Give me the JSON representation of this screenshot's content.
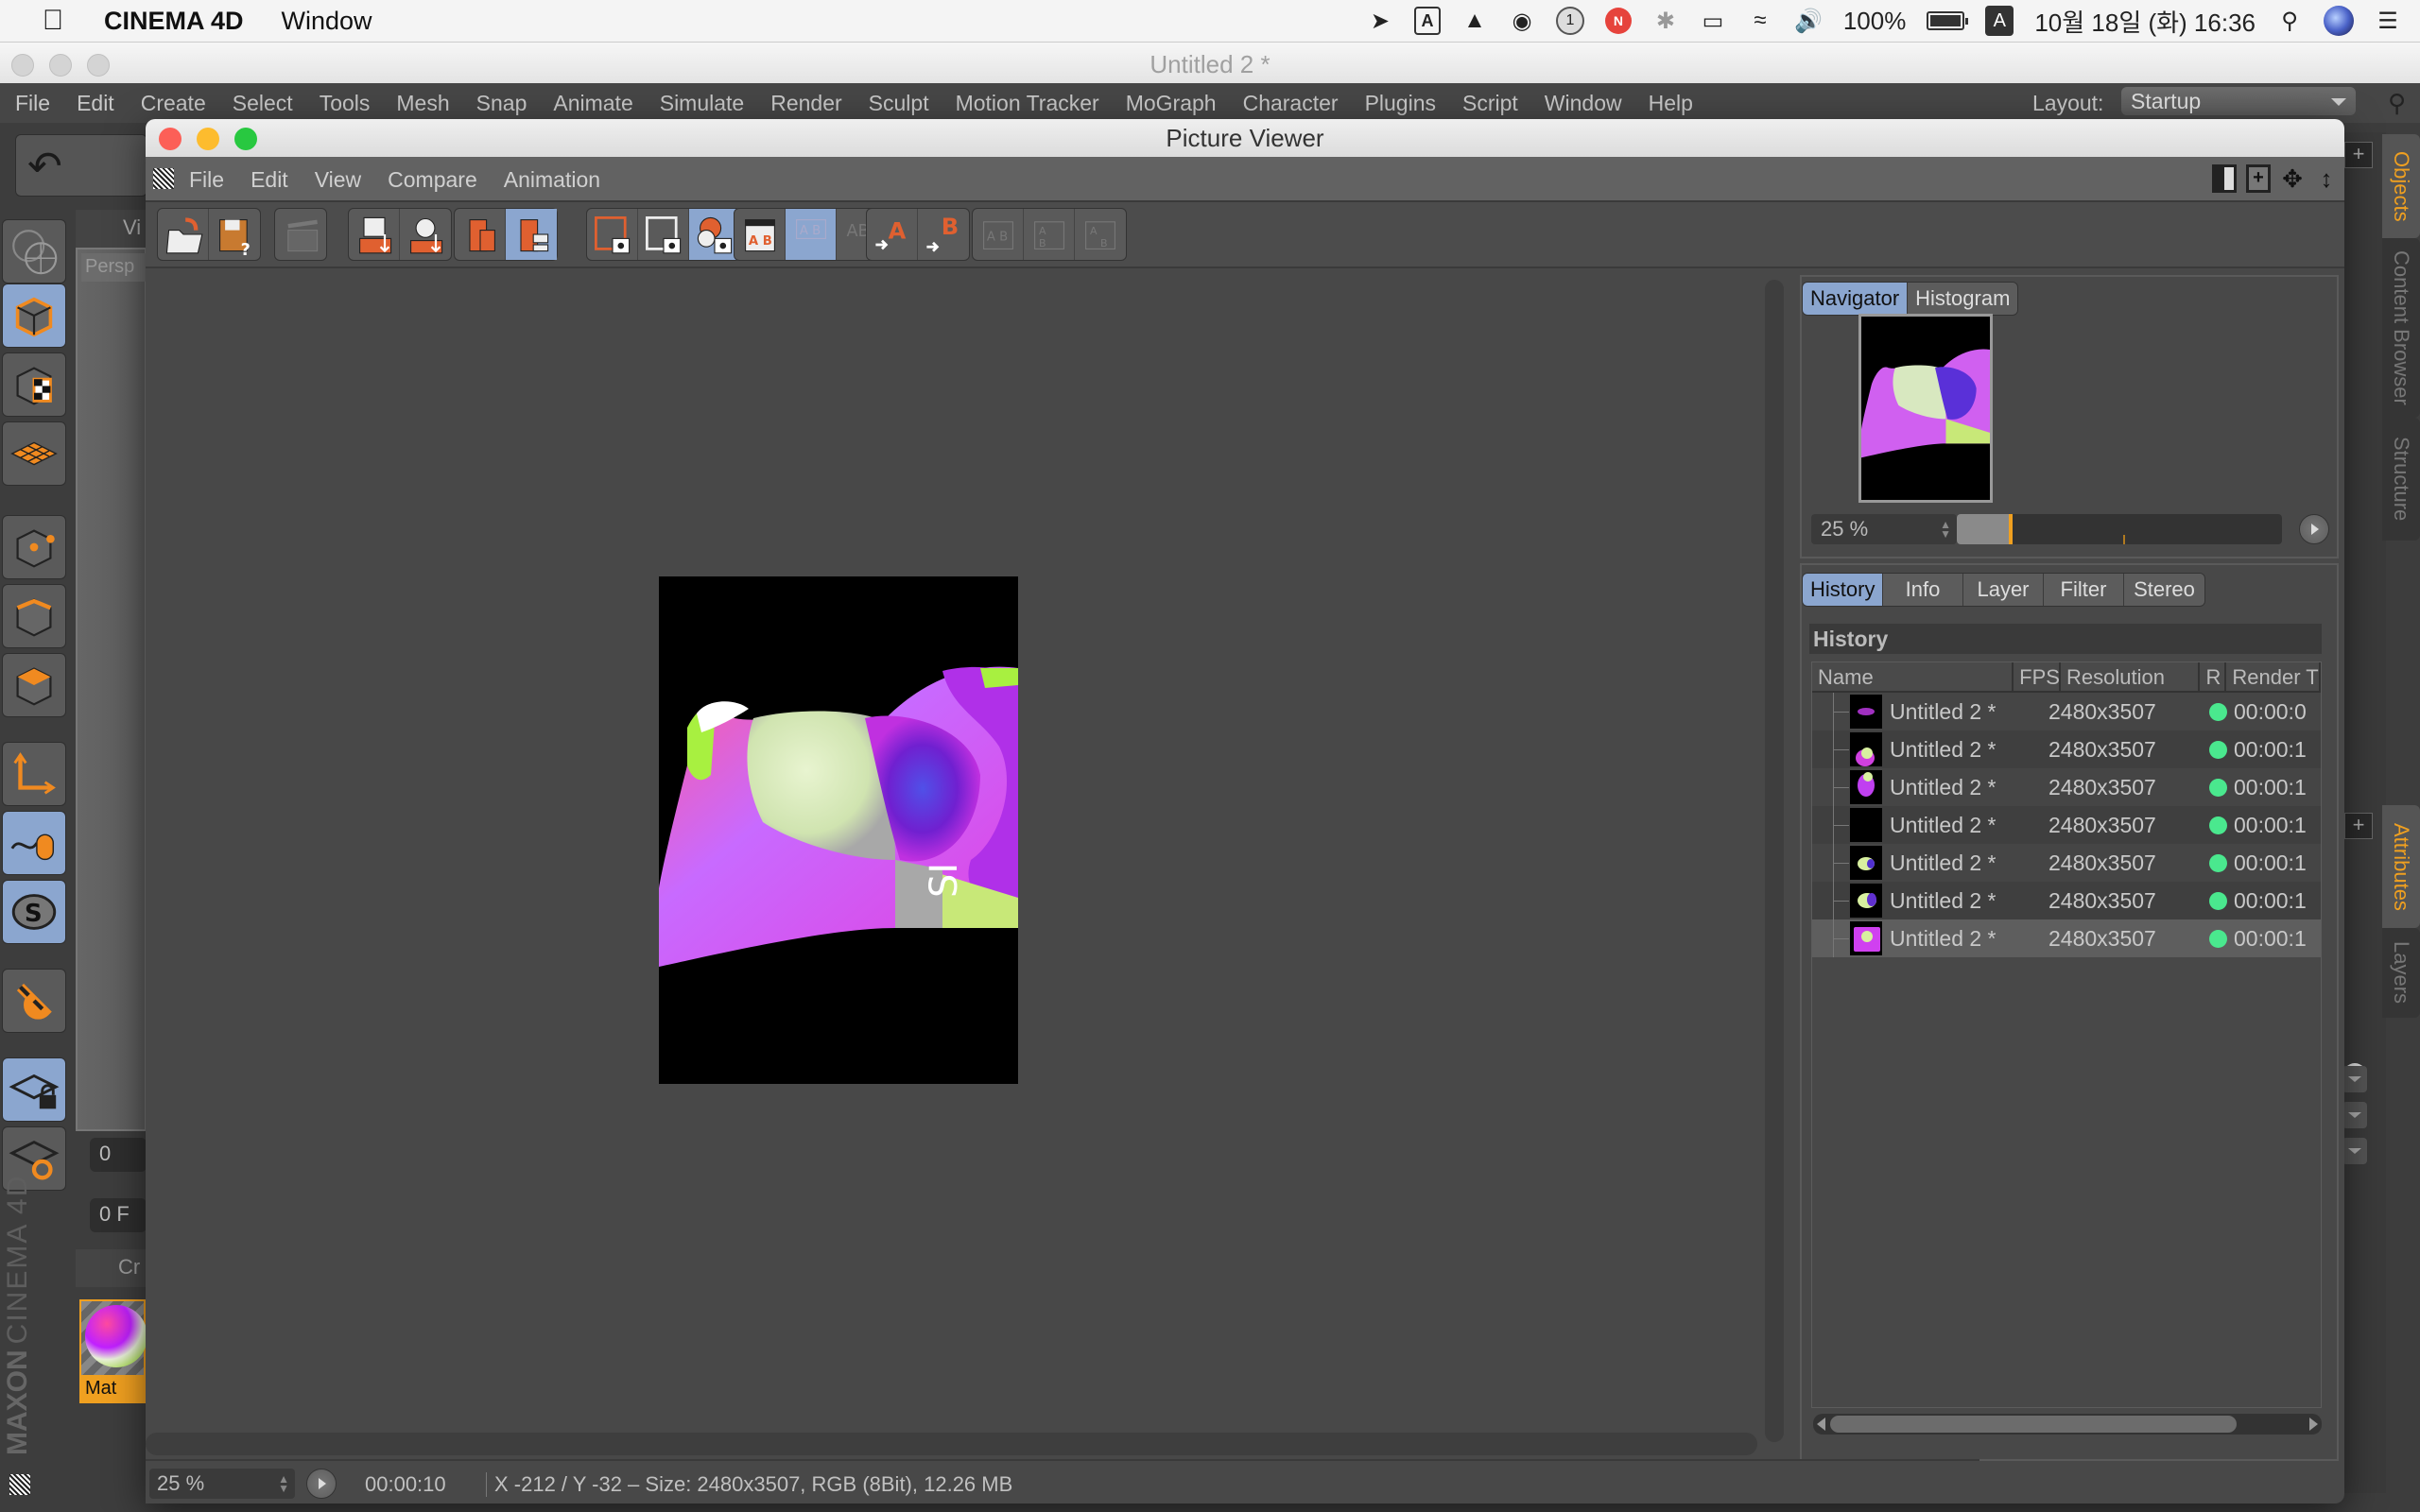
{
  "mac_menubar": {
    "app_name": "CINEMA 4D",
    "menu": "Window",
    "status_icons": [
      "rocket-icon",
      "adobe-icon",
      "drive-icon",
      "audio-icon",
      "notification-1-icon",
      "chat-icon",
      "bluetooth-icon",
      "airplay-icon",
      "wifi-icon",
      "volume-icon"
    ],
    "notification_count": "1",
    "chat_badge": "N",
    "battery": "100%",
    "input_method": "A",
    "adobe_label": "A",
    "datetime": "10월 18일 (화) 16:36"
  },
  "main_window": {
    "title": "Untitled 2 *",
    "menu": [
      "File",
      "Edit",
      "Create",
      "Select",
      "Tools",
      "Mesh",
      "Snap",
      "Animate",
      "Simulate",
      "Render",
      "Sculpt",
      "Motion Tracker",
      "MoGraph",
      "Character",
      "Plugins",
      "Script",
      "Window",
      "Help"
    ],
    "layout_label": "Layout:",
    "layout_value": "Startup",
    "viewport_menu_stub": "Vi",
    "viewport_camera_stub": "Persp",
    "timeline_start": "0",
    "frame_field": "0 F",
    "material_panel_stub": "Cr",
    "material_name": "Mat",
    "brand_maxon": "MAXON",
    "brand_cinema": "CINEMA 4D",
    "left_tools": [
      {
        "name": "model-mode",
        "active": true
      },
      {
        "name": "texture-mode",
        "active": false
      },
      {
        "name": "workplane-mode",
        "active": false
      },
      {
        "name": "points-mode",
        "active": false
      },
      {
        "name": "edges-mode",
        "active": false
      },
      {
        "name": "polygons-mode",
        "active": false
      },
      {
        "name": "axis-mode",
        "active": false
      },
      {
        "name": "tweak-mode",
        "active": true
      },
      {
        "name": "solo-mode",
        "active": true
      },
      {
        "name": "snap-magnet",
        "active": false
      },
      {
        "name": "lock-workplane",
        "active": true
      },
      {
        "name": "align-workplane",
        "active": false
      }
    ],
    "right_tabs_top": [
      {
        "label": "Objects",
        "active": true
      },
      {
        "label": "Content Browser",
        "active": false
      },
      {
        "label": "Structure",
        "active": false
      }
    ],
    "right_tabs_bottom": [
      {
        "label": "Attributes",
        "active": true
      },
      {
        "label": "Layers",
        "active": false
      }
    ]
  },
  "picture_viewer": {
    "title": "Picture Viewer",
    "menu": [
      "File",
      "Edit",
      "View",
      "Compare",
      "Animation"
    ],
    "toolbar_groups": [
      [
        {
          "name": "open",
          "active": false
        },
        {
          "name": "save-as",
          "active": false
        }
      ],
      [
        {
          "name": "clapboard",
          "active": false,
          "disabled": true
        }
      ],
      [
        {
          "name": "add-to-history",
          "active": false
        },
        {
          "name": "save-snapshot",
          "active": false
        }
      ],
      [
        {
          "name": "delete-from-history",
          "active": false
        },
        {
          "name": "history-filter",
          "active": true
        }
      ],
      [
        {
          "name": "show-current",
          "active": false
        },
        {
          "name": "show-region",
          "active": false
        },
        {
          "name": "show-lut",
          "active": true
        }
      ],
      [
        {
          "name": "compare-ab",
          "active": false
        },
        {
          "name": "compare-split",
          "active": true
        },
        {
          "name": "compare-difference",
          "active": false,
          "disabled": true
        }
      ],
      [
        {
          "name": "set-a",
          "active": false
        },
        {
          "name": "set-b",
          "active": false
        }
      ],
      [
        {
          "name": "swap-ab",
          "active": false,
          "disabled": true
        },
        {
          "name": "vertical-ab",
          "active": false,
          "disabled": true
        },
        {
          "name": "flip-ab",
          "active": false,
          "disabled": true
        }
      ]
    ],
    "render_text_fragment": "SI",
    "status": {
      "zoom": "25 %",
      "time": "00:00:10",
      "info": "X -212 / Y -32 – Size: 2480x3507, RGB (8Bit), 12.26 MB"
    },
    "navigator": {
      "tabs": [
        {
          "label": "Navigator",
          "active": true
        },
        {
          "label": "Histogram",
          "active": false
        }
      ],
      "zoom": "25 %",
      "zoom_slider_fraction": 0.08
    },
    "history_panel": {
      "tabs": [
        {
          "label": "History",
          "active": true
        },
        {
          "label": "Info",
          "active": false
        },
        {
          "label": "Layer",
          "active": false
        },
        {
          "label": "Filter",
          "active": false
        },
        {
          "label": "Stereo",
          "active": false
        }
      ],
      "heading": "History",
      "columns": [
        "Name",
        "FPS",
        "Resolution",
        "R",
        "Render T"
      ],
      "rows": [
        {
          "name": "Untitled 2 *",
          "fps": "",
          "resolution": "2480x3507",
          "status": "ok",
          "render_time": "00:00:0",
          "selected": false
        },
        {
          "name": "Untitled 2 *",
          "fps": "",
          "resolution": "2480x3507",
          "status": "ok",
          "render_time": "00:00:1",
          "selected": false
        },
        {
          "name": "Untitled 2 *",
          "fps": "",
          "resolution": "2480x3507",
          "status": "ok",
          "render_time": "00:00:1",
          "selected": false
        },
        {
          "name": "Untitled 2 *",
          "fps": "",
          "resolution": "2480x3507",
          "status": "ok",
          "render_time": "00:00:1",
          "selected": false
        },
        {
          "name": "Untitled 2 *",
          "fps": "",
          "resolution": "2480x3507",
          "status": "ok",
          "render_time": "00:00:1",
          "selected": false
        },
        {
          "name": "Untitled 2 *",
          "fps": "",
          "resolution": "2480x3507",
          "status": "ok",
          "render_time": "00:00:1",
          "selected": false
        },
        {
          "name": "Untitled 2 *",
          "fps": "",
          "resolution": "2480x3507",
          "status": "ok",
          "render_time": "00:00:1",
          "selected": true
        }
      ]
    }
  },
  "colors": {
    "accent_orange": "#f0a020",
    "tab_active_blue": "#8ba6cf",
    "status_ok_green": "#4ae88e",
    "traffic_red": "#fc5f57",
    "traffic_yellow": "#fdbc2e",
    "traffic_green": "#28c840"
  }
}
